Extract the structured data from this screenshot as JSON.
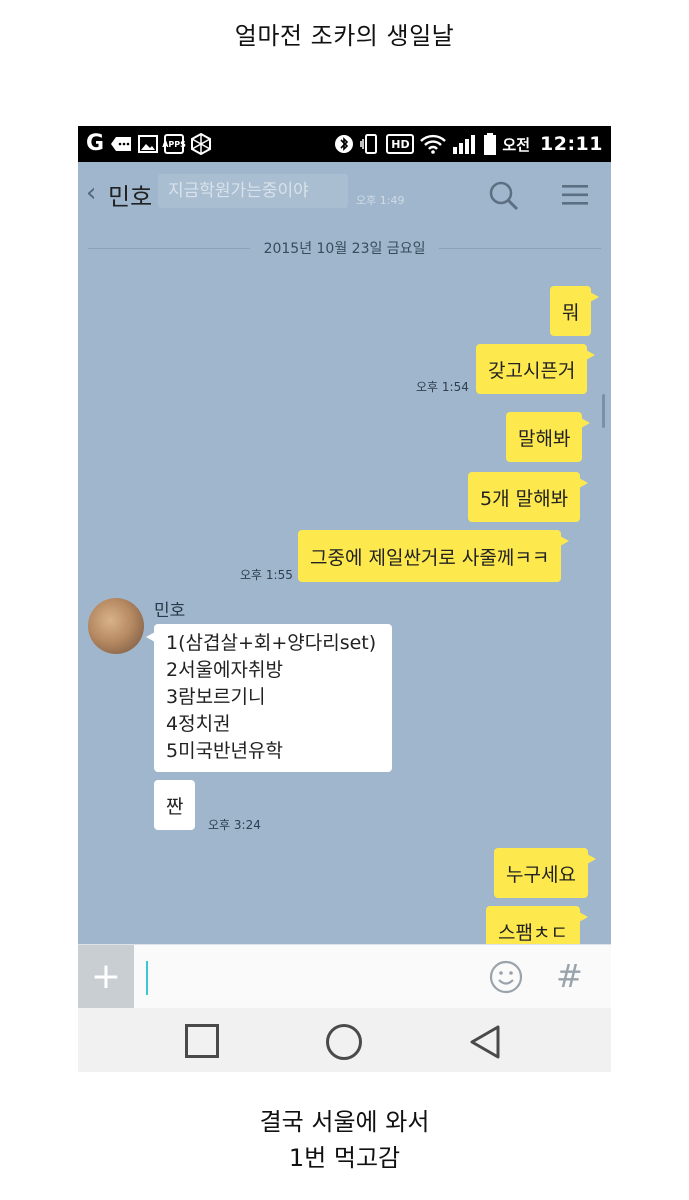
{
  "captions": {
    "top": "얼마전 조카의 생일날",
    "bottom_line1": "결국 서울에 와서",
    "bottom_line2": "1번 먹고감"
  },
  "status_bar": {
    "ampm": "오전",
    "time": "12:11",
    "apps_label": "APPS",
    "hd_label": "HD"
  },
  "header": {
    "back": "‹",
    "contact_name": "민호",
    "ghost_message": "지금학원가는중이야",
    "ghost_time": "오후 1:49"
  },
  "date_divider": "2015년 10월 23일 금요일",
  "messages": [
    {
      "from": "me",
      "text": "뭐"
    },
    {
      "from": "me",
      "text": "갖고시픈거",
      "time": "오후 1:54"
    },
    {
      "from": "me",
      "text": "말해봐"
    },
    {
      "from": "me",
      "text": "5개 말해봐"
    },
    {
      "from": "me",
      "text": "그중에 제일싼거로 사줄께ㅋㅋ",
      "time": "오후 1:55"
    },
    {
      "from": "them",
      "lines": [
        "1(삼겹살+회+양다리set)",
        "2서울에자취방",
        "3람보르기니",
        "4정치권",
        "5미국반년유학"
      ]
    },
    {
      "from": "them",
      "text": "짠",
      "time": "오후 3:24"
    },
    {
      "from": "me",
      "text": "누구세요"
    },
    {
      "from": "me",
      "text": "스팸ㅊㄷ"
    }
  ],
  "sender": {
    "name": "민호"
  },
  "input_bar": {
    "plus": "+",
    "hash": "#"
  },
  "colors": {
    "my_bubble": "#fde94d",
    "chat_bg": "#9fb6cc",
    "their_bubble": "#ffffff"
  }
}
